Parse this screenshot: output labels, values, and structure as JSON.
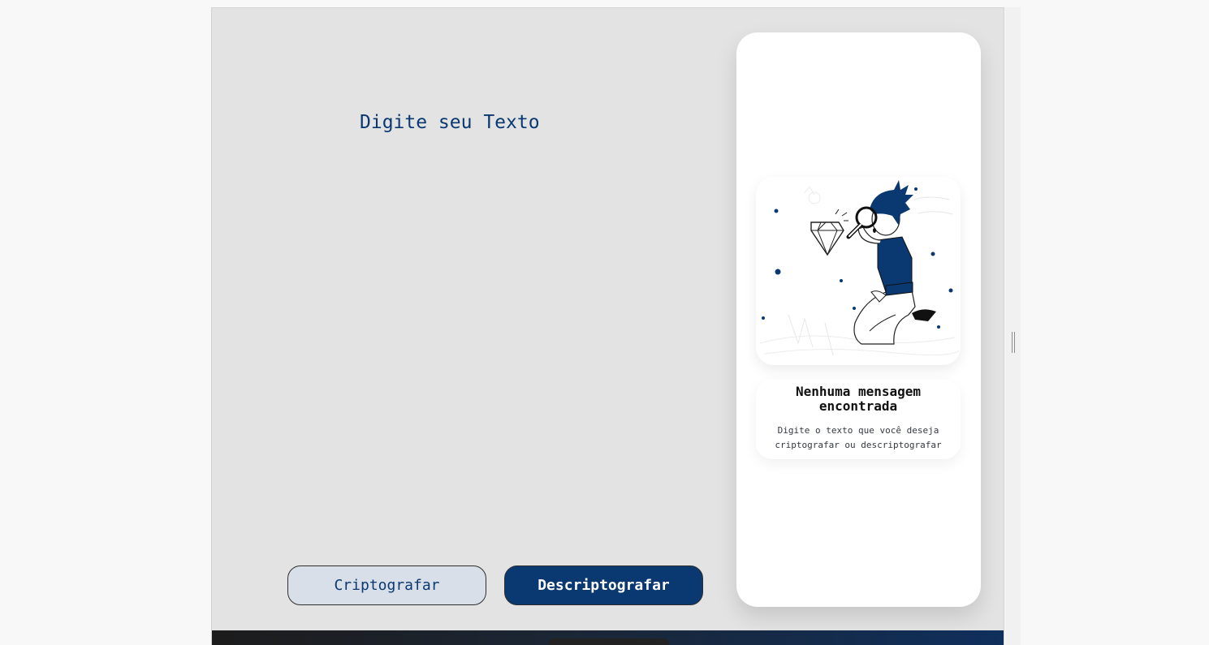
{
  "input": {
    "placeholder": "Digite seu Texto"
  },
  "buttons": {
    "encrypt_label": "Criptografar",
    "decrypt_label": "Descriptografar"
  },
  "output": {
    "title": "Nenhuma mensagem encontrada",
    "subtitle": "Digite o texto que você deseja criptografar ou descriptografar",
    "illustration_icon": "person-magnifying-glass-diamond-illustration"
  },
  "colors": {
    "accent": "#0a3871",
    "encrypt_bg": "#d8dfe8",
    "panel_bg": "#e3e3e3",
    "card_bg": "#ffffff"
  }
}
